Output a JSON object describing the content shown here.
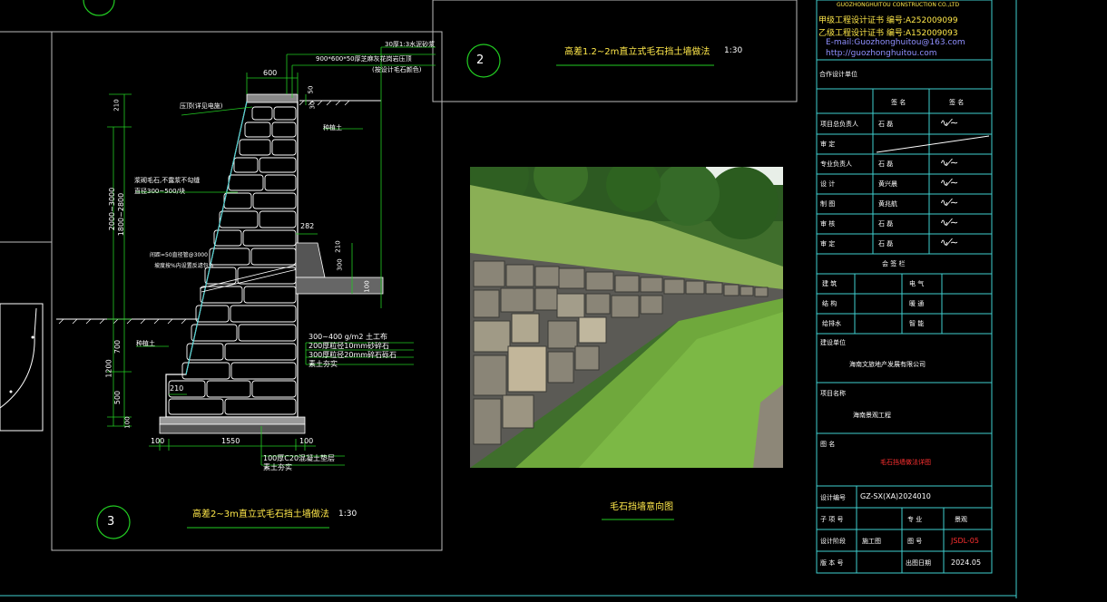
{
  "company": {
    "name_en": "GUOZHONGHUITOU CONSTRUCTION CO.,LTD",
    "cert_a": "甲级工程设计证书 编号:A252009099",
    "cert_b": "乙级工程设计证书 编号:A152009093",
    "email": "E-mail:Guozhonghuitou@163.com",
    "web": "http://guozhonghuitou.com",
    "partner": "合作设计单位"
  },
  "signoff": {
    "head_name": "签 名",
    "head_sign": "签 名",
    "rows": [
      {
        "role": "项目总负责人",
        "name": "石  磊"
      },
      {
        "role": "审  定",
        "name": ""
      },
      {
        "role": "专业负责人",
        "name": "石  磊"
      },
      {
        "role": "设  计",
        "name": "黄兴晨"
      },
      {
        "role": "制  图",
        "name": "黄兆航"
      },
      {
        "role": "审  核",
        "name": "石  磊"
      },
      {
        "role": "审  定",
        "name": "石  磊"
      }
    ],
    "meeting_title": "会 签 栏",
    "meeting": [
      [
        "建 筑",
        "电 气"
      ],
      [
        "结 构",
        "暖 通"
      ],
      [
        "给排水",
        "智 能"
      ]
    ]
  },
  "project": {
    "client_label": "建设单位",
    "client": "海南文旅地产发展有限公司",
    "name_label": "项目名称",
    "name": "海南景观工程",
    "drawing_label": "图  名",
    "drawing_name": "毛石挡墙做法详图",
    "number_label": "设计编号",
    "number": "GZ-SX(XA)2024010",
    "sub_label": "子 项 号",
    "discipline_label": "专  业",
    "discipline": "景观",
    "phase_label": "设计阶段",
    "phase": "施工图",
    "sheet_label": "图  号",
    "sheet": "JSDL-05",
    "version_label": "版 本 号",
    "date_label": "出图日期",
    "date": "2024.05"
  },
  "detail2": {
    "num": "2",
    "title": "高差1.2~2m直立式毛石挡土墙做法",
    "scale": "1:30"
  },
  "detail3": {
    "num": "3",
    "title": "高差2~3m直立式毛石挡土墙做法",
    "scale": "1:30"
  },
  "photo_caption": "毛石挡墙意向图",
  "dims": {
    "top_w": "600",
    "cap_h": "50",
    "cap_h2": "30",
    "left_210": "210",
    "h_total": "2000~3000",
    "h_sub": "1800~2800",
    "h_700": "700",
    "h_1200": "1200",
    "h_500": "500",
    "h_100": "100",
    "drain_w": "282",
    "drain_h": "210",
    "drain_h2": "300",
    "drain_100": "100",
    "toe": "210",
    "base_l": "100",
    "base_w": "1550",
    "base_r": "100"
  },
  "notes": {
    "n1": "30厚1:3水泥砂浆",
    "n2": "900*600*50厚芝麻灰花岗岩压顶",
    "n3": "(按设计毛石颜色)",
    "coping": "压顶(详见电施)",
    "fill": "种植土",
    "stone": "浆砌毛石,不露浆不勾缝",
    "stone2": "直径300~500/块",
    "weep": "间距=50直径管@3000",
    "weep2": "坡度按%内设置反滤包%",
    "soil_l": "种植土",
    "g1": "300~400 g/m2 土工布",
    "g2": "200厚粒径10mm砂碎石",
    "g3": "300厚粒径20mm碎石砾石",
    "g4": "素土夯实",
    "b1": "100厚C20混凝土垫层",
    "b2": "素土夯实"
  }
}
